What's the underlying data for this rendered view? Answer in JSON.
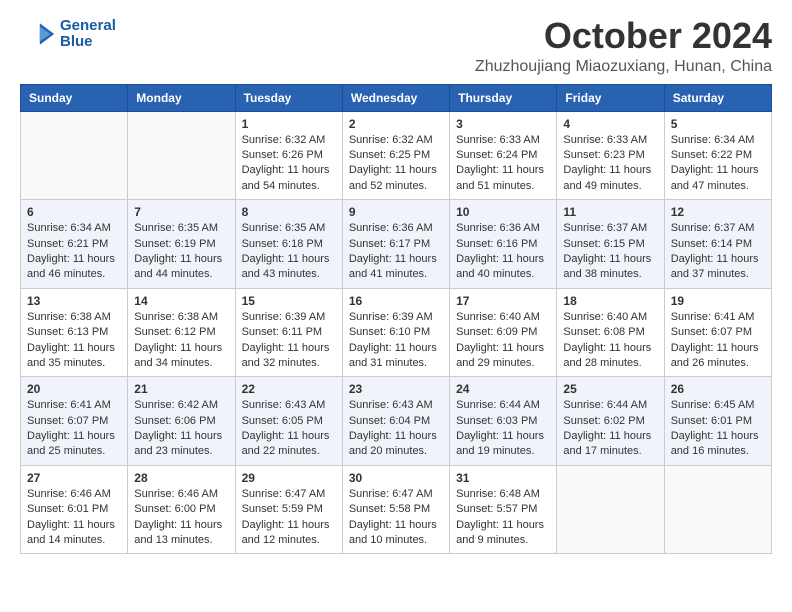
{
  "header": {
    "logo_line1": "General",
    "logo_line2": "Blue",
    "month": "October 2024",
    "location": "Zhuzhoujiang Miaozuxiang, Hunan, China"
  },
  "days_of_week": [
    "Sunday",
    "Monday",
    "Tuesday",
    "Wednesday",
    "Thursday",
    "Friday",
    "Saturday"
  ],
  "weeks": [
    [
      {
        "day": "",
        "info": ""
      },
      {
        "day": "",
        "info": ""
      },
      {
        "day": "1",
        "info": "Sunrise: 6:32 AM\nSunset: 6:26 PM\nDaylight: 11 hours and 54 minutes."
      },
      {
        "day": "2",
        "info": "Sunrise: 6:32 AM\nSunset: 6:25 PM\nDaylight: 11 hours and 52 minutes."
      },
      {
        "day": "3",
        "info": "Sunrise: 6:33 AM\nSunset: 6:24 PM\nDaylight: 11 hours and 51 minutes."
      },
      {
        "day": "4",
        "info": "Sunrise: 6:33 AM\nSunset: 6:23 PM\nDaylight: 11 hours and 49 minutes."
      },
      {
        "day": "5",
        "info": "Sunrise: 6:34 AM\nSunset: 6:22 PM\nDaylight: 11 hours and 47 minutes."
      }
    ],
    [
      {
        "day": "6",
        "info": "Sunrise: 6:34 AM\nSunset: 6:21 PM\nDaylight: 11 hours and 46 minutes."
      },
      {
        "day": "7",
        "info": "Sunrise: 6:35 AM\nSunset: 6:19 PM\nDaylight: 11 hours and 44 minutes."
      },
      {
        "day": "8",
        "info": "Sunrise: 6:35 AM\nSunset: 6:18 PM\nDaylight: 11 hours and 43 minutes."
      },
      {
        "day": "9",
        "info": "Sunrise: 6:36 AM\nSunset: 6:17 PM\nDaylight: 11 hours and 41 minutes."
      },
      {
        "day": "10",
        "info": "Sunrise: 6:36 AM\nSunset: 6:16 PM\nDaylight: 11 hours and 40 minutes."
      },
      {
        "day": "11",
        "info": "Sunrise: 6:37 AM\nSunset: 6:15 PM\nDaylight: 11 hours and 38 minutes."
      },
      {
        "day": "12",
        "info": "Sunrise: 6:37 AM\nSunset: 6:14 PM\nDaylight: 11 hours and 37 minutes."
      }
    ],
    [
      {
        "day": "13",
        "info": "Sunrise: 6:38 AM\nSunset: 6:13 PM\nDaylight: 11 hours and 35 minutes."
      },
      {
        "day": "14",
        "info": "Sunrise: 6:38 AM\nSunset: 6:12 PM\nDaylight: 11 hours and 34 minutes."
      },
      {
        "day": "15",
        "info": "Sunrise: 6:39 AM\nSunset: 6:11 PM\nDaylight: 11 hours and 32 minutes."
      },
      {
        "day": "16",
        "info": "Sunrise: 6:39 AM\nSunset: 6:10 PM\nDaylight: 11 hours and 31 minutes."
      },
      {
        "day": "17",
        "info": "Sunrise: 6:40 AM\nSunset: 6:09 PM\nDaylight: 11 hours and 29 minutes."
      },
      {
        "day": "18",
        "info": "Sunrise: 6:40 AM\nSunset: 6:08 PM\nDaylight: 11 hours and 28 minutes."
      },
      {
        "day": "19",
        "info": "Sunrise: 6:41 AM\nSunset: 6:07 PM\nDaylight: 11 hours and 26 minutes."
      }
    ],
    [
      {
        "day": "20",
        "info": "Sunrise: 6:41 AM\nSunset: 6:07 PM\nDaylight: 11 hours and 25 minutes."
      },
      {
        "day": "21",
        "info": "Sunrise: 6:42 AM\nSunset: 6:06 PM\nDaylight: 11 hours and 23 minutes."
      },
      {
        "day": "22",
        "info": "Sunrise: 6:43 AM\nSunset: 6:05 PM\nDaylight: 11 hours and 22 minutes."
      },
      {
        "day": "23",
        "info": "Sunrise: 6:43 AM\nSunset: 6:04 PM\nDaylight: 11 hours and 20 minutes."
      },
      {
        "day": "24",
        "info": "Sunrise: 6:44 AM\nSunset: 6:03 PM\nDaylight: 11 hours and 19 minutes."
      },
      {
        "day": "25",
        "info": "Sunrise: 6:44 AM\nSunset: 6:02 PM\nDaylight: 11 hours and 17 minutes."
      },
      {
        "day": "26",
        "info": "Sunrise: 6:45 AM\nSunset: 6:01 PM\nDaylight: 11 hours and 16 minutes."
      }
    ],
    [
      {
        "day": "27",
        "info": "Sunrise: 6:46 AM\nSunset: 6:01 PM\nDaylight: 11 hours and 14 minutes."
      },
      {
        "day": "28",
        "info": "Sunrise: 6:46 AM\nSunset: 6:00 PM\nDaylight: 11 hours and 13 minutes."
      },
      {
        "day": "29",
        "info": "Sunrise: 6:47 AM\nSunset: 5:59 PM\nDaylight: 11 hours and 12 minutes."
      },
      {
        "day": "30",
        "info": "Sunrise: 6:47 AM\nSunset: 5:58 PM\nDaylight: 11 hours and 10 minutes."
      },
      {
        "day": "31",
        "info": "Sunrise: 6:48 AM\nSunset: 5:57 PM\nDaylight: 11 hours and 9 minutes."
      },
      {
        "day": "",
        "info": ""
      },
      {
        "day": "",
        "info": ""
      }
    ]
  ]
}
